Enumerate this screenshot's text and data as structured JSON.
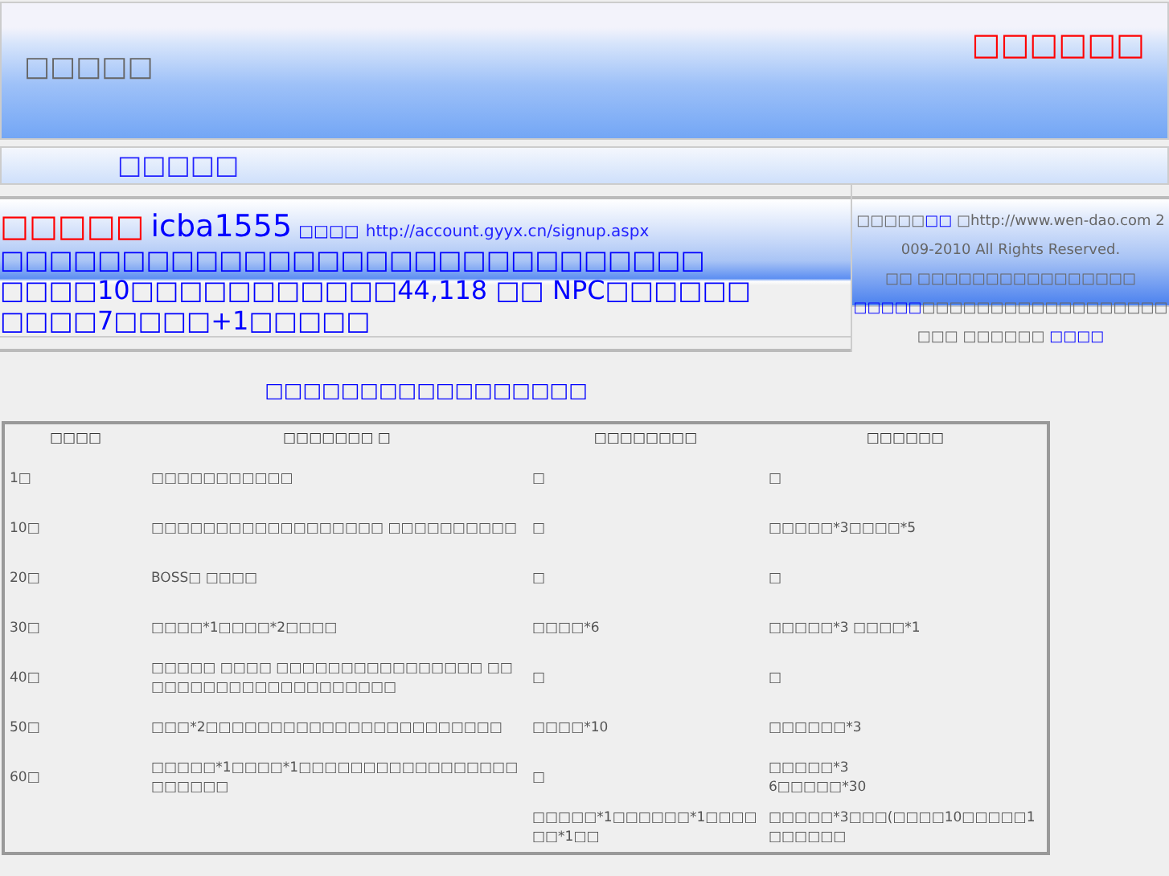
{
  "header": {
    "site_title": "□□□□□",
    "notice": "□□□□□□"
  },
  "nav": {
    "label": "□□□□□"
  },
  "info": {
    "account_label": "□□□□□",
    "account": "icba1555",
    "signup_label": "□□□□",
    "signup_url": "http://account.gyyx.cn/signup.aspx",
    "lines": [
      "□□□□□□□□□□□□□□□□□□□□□□□□□□□□□",
      "□□□□10□□□□□□□□□□□44,118 □□ NPC□□□□□□",
      "□□□□7□□□□+1□□□□□"
    ]
  },
  "side_note": {
    "paragraphs": [
      [
        {
          "kind": "text",
          "text": "□□□□□"
        },
        {
          "kind": "link",
          "text": "□□"
        },
        {
          "kind": "text",
          "text": " □http://www.wen-dao.com 2009-2010 All Rights Reserved."
        }
      ],
      [
        {
          "kind": "text",
          "text": "□□ □□□□□□□□□□□□□□□□"
        },
        {
          "kind": "link",
          "text": "□□□□□"
        },
        {
          "kind": "text",
          "text": "□□□□□□□□□□□□□□□□□□□□□ □□□□□□ "
        },
        {
          "kind": "link",
          "text": "□□□□"
        }
      ]
    ]
  },
  "table": {
    "title": "□□□□□□□□□□□□□□□□□",
    "columns": [
      "□□□□",
      "□□□□□□□ □",
      "□□□□□□□□",
      "□□□□□□"
    ],
    "rows": [
      [
        "1□",
        "□□□□□□□□□□□",
        "□",
        "□"
      ],
      [
        "10□",
        "□□□□□□□□□□□□□□□□□□ □□□□□□□□□□",
        "□",
        "□□□□□*3□□□□*5"
      ],
      [
        "20□",
        "BOSS□ □□□□",
        "□",
        "□"
      ],
      [
        "30□",
        "□□□□*1□□□□*2□□□□",
        "□□□□*6",
        "□□□□□*3 □□□□*1"
      ],
      [
        "40□",
        "□□□□□ □□□□ □□□□□□□□□□□□□□□□ □□□□□□□□□□□□□□□□□□□□□",
        "□",
        "□"
      ],
      [
        "50□",
        "□□□*2□□□□□□□□□□□□□□□□□□□□□□□",
        "□□□□*10",
        "□□□□□□*3"
      ],
      [
        "60□",
        "□□□□□*1□□□□*1□□□□□□□□□□□□□□□□□□□□□□□",
        "□",
        "□□□□□*3\n6□□□□□*30"
      ],
      [
        "",
        "",
        "□□□□□*1□□□□□□*1□□□□□□*1□□",
        "□□□□□*3□□□(□□□□10□□□□□1□□□□□□"
      ]
    ]
  }
}
